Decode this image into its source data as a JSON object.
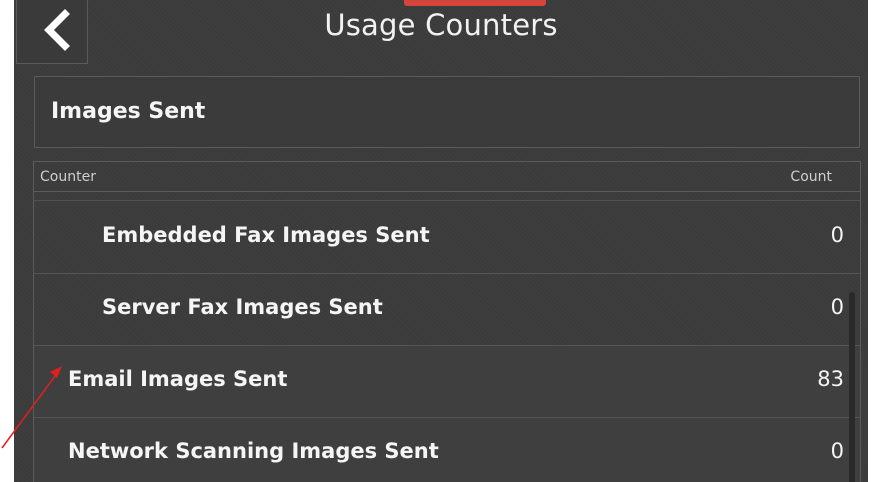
{
  "header": {
    "title": "Usage Counters",
    "back_icon": "chevron-left-icon"
  },
  "section": {
    "label": "Images Sent"
  },
  "table": {
    "columns": [
      "Counter",
      "Count"
    ],
    "rows": [
      {
        "name": "Embedded Fax Images Sent",
        "count": "0"
      },
      {
        "name": "Server Fax Images Sent",
        "count": "0"
      },
      {
        "name": "Email Images Sent",
        "count": "83"
      },
      {
        "name": "Network Scanning Images Sent",
        "count": "0"
      }
    ]
  },
  "colors": {
    "background": "#3b3b3b",
    "accent": "#d6453a",
    "annotation_arrow": "#e02020"
  }
}
